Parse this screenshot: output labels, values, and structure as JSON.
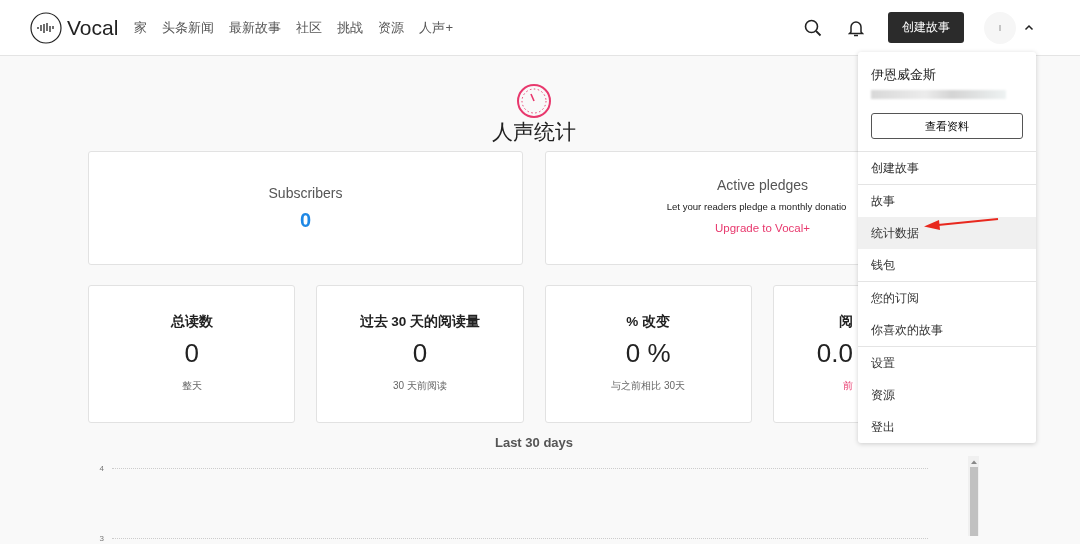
{
  "header": {
    "logo": "Vocal",
    "nav": [
      {
        "label": "家"
      },
      {
        "label": "头条新闻"
      },
      {
        "label": "最新故事"
      },
      {
        "label": "社区"
      },
      {
        "label": "挑战"
      },
      {
        "label": "资源"
      },
      {
        "label": "人声+"
      }
    ],
    "create_button": "创建故事",
    "avatar_initial": "I",
    "menu_expanded": true
  },
  "page": {
    "title": "人声统计"
  },
  "summary_cards": [
    {
      "kind": "count",
      "title": "Subscribers",
      "value": "0"
    },
    {
      "kind": "promo",
      "title": "Active pledges",
      "text": "Let your readers pledge a monthly donatio",
      "link": "Upgrade to Vocal+"
    }
  ],
  "stat_cards": [
    {
      "kind": "plain",
      "title": "总读数",
      "value": "0",
      "note": "整天"
    },
    {
      "kind": "plain",
      "title": "过去 30 天的阅读量",
      "value": "0",
      "note": "30 天前阅读"
    },
    {
      "kind": "plain",
      "title": "% 改变",
      "value": "0 %",
      "note": "与之前相比 30天"
    },
    {
      "kind": "link",
      "title": "阅",
      "value": "0.0",
      "note": "前"
    }
  ],
  "chart": {
    "title": "Last 30 days",
    "y_labels": [
      "4",
      "3"
    ]
  },
  "user_menu": {
    "name": "伊恩威金斯",
    "profile_button": "查看资料",
    "groups": [
      [
        {
          "label": "创建故事",
          "selected": false
        }
      ],
      [
        {
          "label": "故事",
          "selected": false
        },
        {
          "label": "统计数据",
          "selected": true
        },
        {
          "label": "钱包",
          "selected": false
        }
      ],
      [
        {
          "label": "您的订阅",
          "selected": false
        },
        {
          "label": "你喜欢的故事",
          "selected": false
        }
      ],
      [
        {
          "label": "设置",
          "selected": false
        },
        {
          "label": "资源",
          "selected": false
        },
        {
          "label": "登出",
          "selected": false
        }
      ]
    ]
  }
}
